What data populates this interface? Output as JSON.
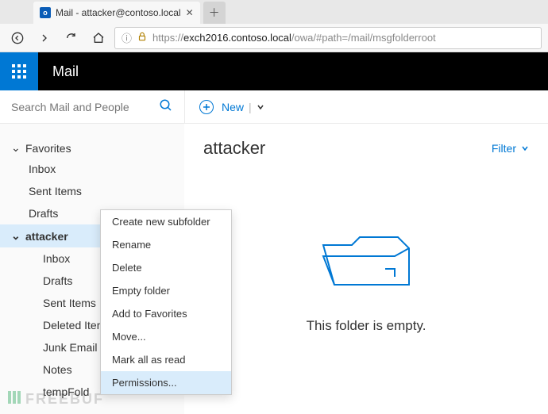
{
  "browser": {
    "tab_title": "Mail - attacker@contoso.local",
    "url_dim1": "https://",
    "url_strong": "exch2016.contoso.local",
    "url_dim2": "/owa/#path=/mail/msgfolderroot"
  },
  "app": {
    "title": "Mail"
  },
  "search": {
    "placeholder": "Search Mail and People"
  },
  "actions": {
    "new_label": "New"
  },
  "sidebar": {
    "favorites_label": "Favorites",
    "fav_items": [
      "Inbox",
      "Sent Items",
      "Drafts"
    ],
    "account_label": "attacker",
    "account_items": [
      "Inbox",
      "Drafts",
      "Sent Items",
      "Deleted Items",
      "Junk Email",
      "Notes",
      "tempFold"
    ]
  },
  "context_menu": {
    "items": [
      "Create new subfolder",
      "Rename",
      "Delete",
      "Empty folder",
      "Add to Favorites",
      "Move...",
      "Mark all as read",
      "Permissions..."
    ],
    "hovered_index": 7
  },
  "content": {
    "folder_title": "attacker",
    "filter_label": "Filter",
    "empty_text": "This folder is empty."
  },
  "watermark": "FREEBUF"
}
